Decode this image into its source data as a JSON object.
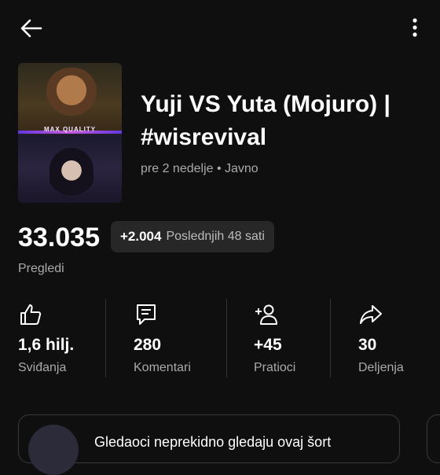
{
  "header": {
    "back_icon": "arrow-left-icon",
    "more_icon": "more-vertical-icon"
  },
  "video": {
    "thumbnail_text": "MAX QUALITY",
    "title": "Yuji VS Yuta (Mojuro) | #wisrevival",
    "meta": "pre 2 nedelje • Javno"
  },
  "views": {
    "count": "33.035",
    "delta": "+2.004",
    "delta_label": "Poslednjih 48 sati",
    "label": "Pregledi"
  },
  "stats": [
    {
      "icon": "thumbs-up-icon",
      "value": "1,6 hilj.",
      "label": "Sviđanja"
    },
    {
      "icon": "comment-icon",
      "value": "280",
      "label": "Komentari"
    },
    {
      "icon": "add-person-icon",
      "value": "+45",
      "label": "Pratioci"
    },
    {
      "icon": "share-icon",
      "value": "30",
      "label": "Deljenja"
    }
  ],
  "card": {
    "text": "Gledaoci neprekidno gledaju ovaj šort"
  },
  "colors": {
    "background": "#0f0f0f",
    "text": "#ffffff",
    "muted": "#aaaaaa",
    "chip": "#272727"
  }
}
